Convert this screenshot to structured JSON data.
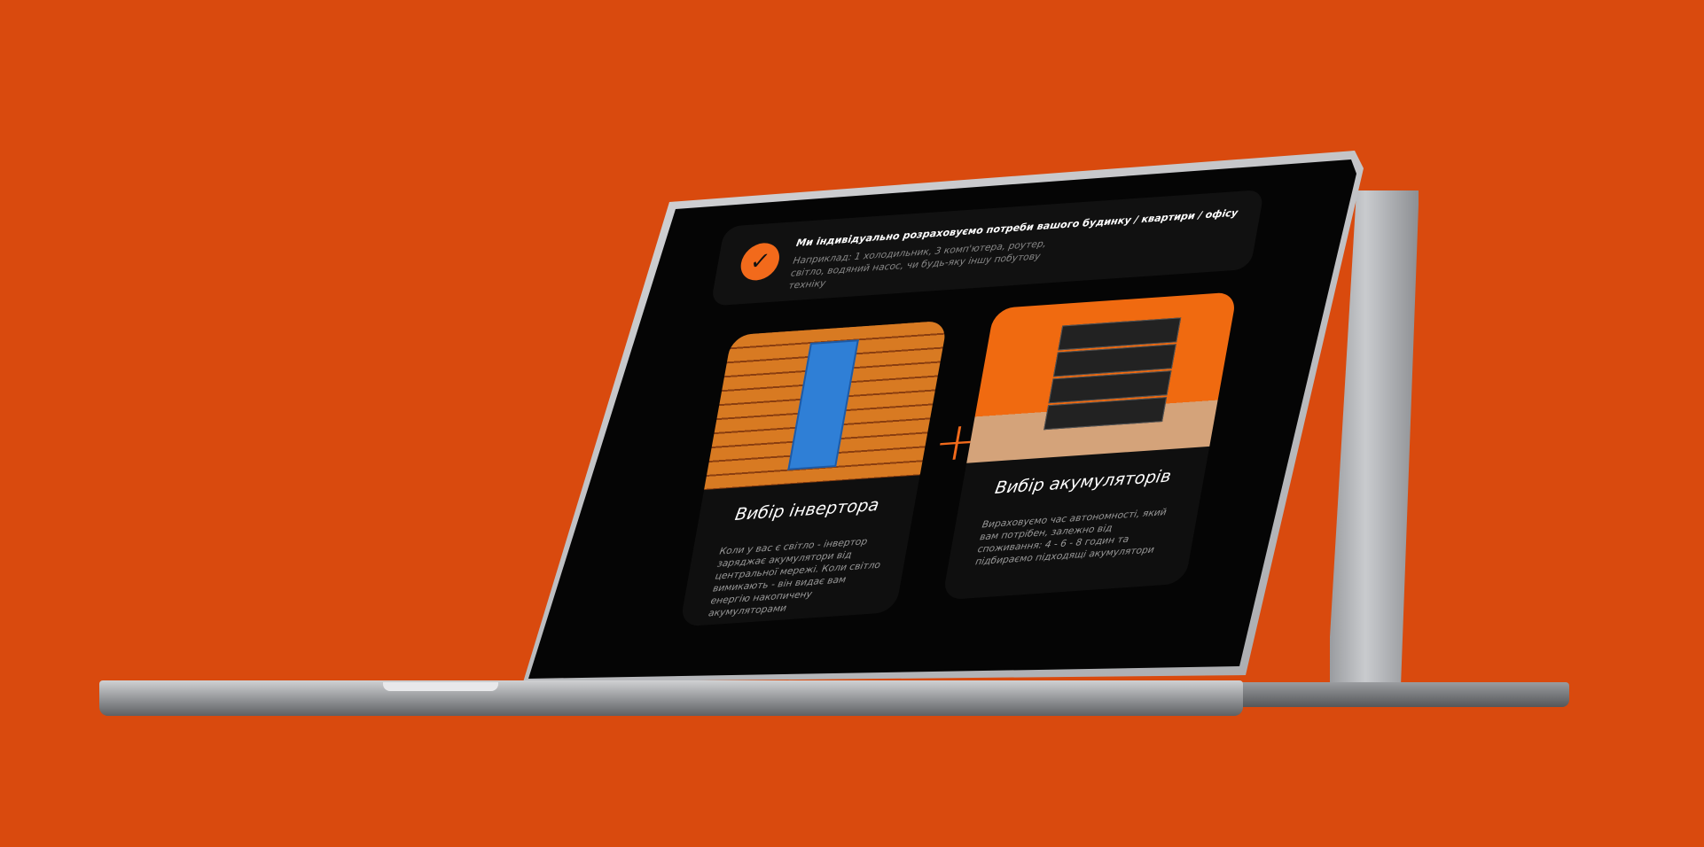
{
  "notice": {
    "icon": "check-icon",
    "title": "Ми індивідуально розраховуємо потреби вашого будинку / квартири / офісу",
    "text": "Наприклад: 1 холодильник, 3 комп'ютера, роутер, світло, водяний насос, чи будь-яку іншу побутову техніку"
  },
  "cards": [
    {
      "title": "Вибір інвертора",
      "text": "Коли у вас є світло - інвертор заряджає акумулятори від центральної мережі. Коли світло вимикають - він видає вам енергію накопичену акумуляторами"
    },
    {
      "title": "Вибір акумуляторів",
      "text": "Вираховуємо час автономності, який вам потрібен, залежно від споживання: 4 - 6 - 8 годин та підбираємо підходящі акумулятори"
    }
  ],
  "plus": "+",
  "colors": {
    "background": "#d94a0e",
    "accent": "#f26a1b",
    "screen": "#050505"
  }
}
